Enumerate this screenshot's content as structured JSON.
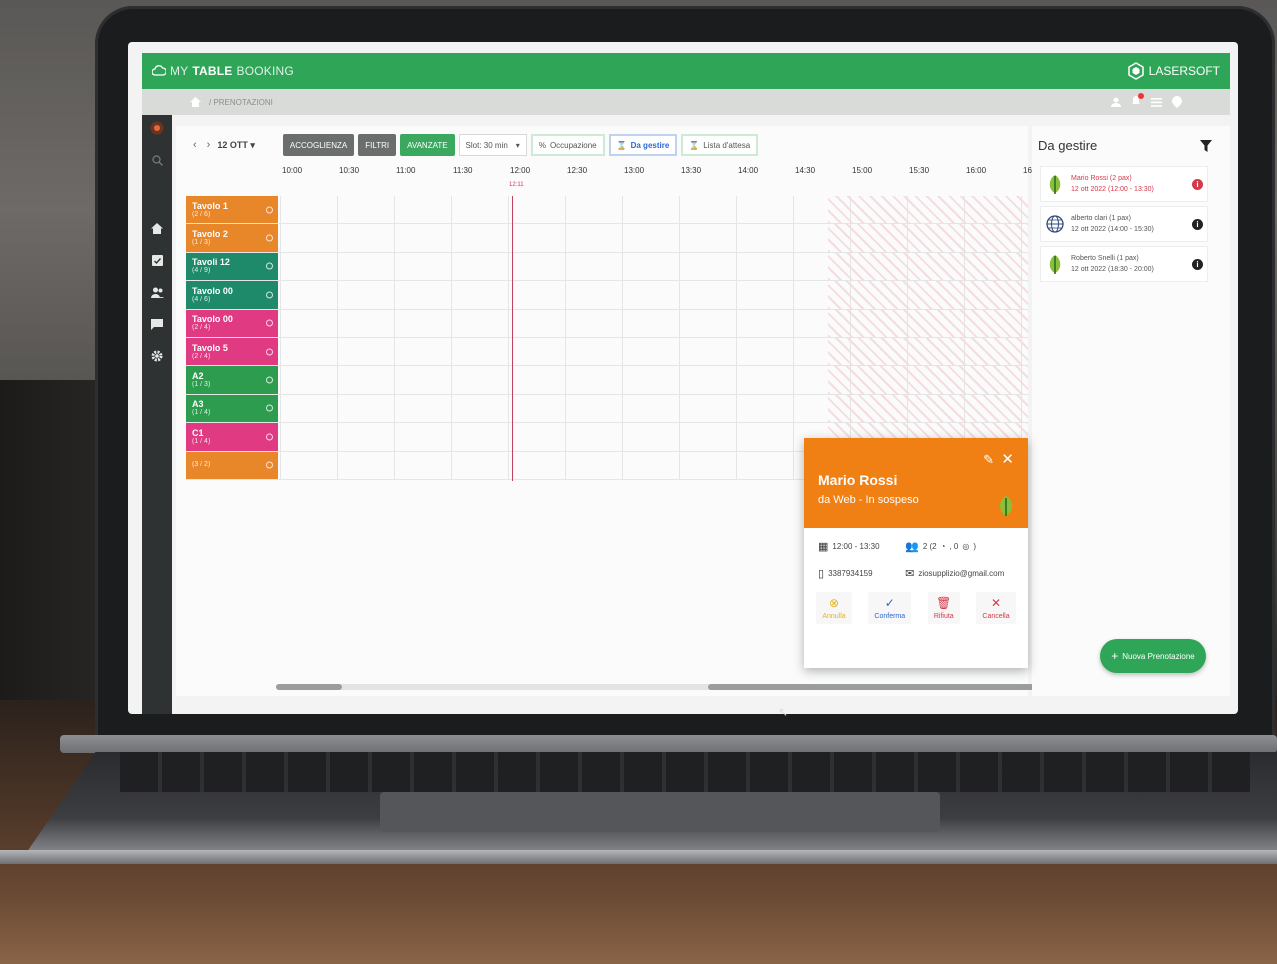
{
  "app": {
    "brand_part1": "MY",
    "brand_part2": "TABLE",
    "brand_part3": "BOOKING",
    "partner": "LASERSOFT"
  },
  "breadcrumb": "/ PRENOTAZIONI",
  "toolbar": {
    "date": "12 OTT",
    "accoglienza": "ACCOGLIENZA",
    "filtri": "FILTRI",
    "avanzate": "AVANZATE",
    "slot": "Slot: 30 min",
    "occupazione": "Occupazione",
    "da_gestire": "Da gestire",
    "lista_attesa": "Lista d'attesa"
  },
  "times": [
    "10:00",
    "10:30",
    "11:00",
    "11:30",
    "12:00",
    "12:30",
    "13:00",
    "13:30",
    "14:00",
    "14:30",
    "15:00",
    "15:30",
    "16:00",
    "16"
  ],
  "now_label": "12:11",
  "tables": [
    {
      "name": "Tavolo 1",
      "cap": "(2 / 6)",
      "color": "#e8862a"
    },
    {
      "name": "Tavolo 2",
      "cap": "(1 / 3)",
      "color": "#e8862a"
    },
    {
      "name": "Tavoli 12",
      "cap": "(4 / 9)",
      "color": "#1f8a6a"
    },
    {
      "name": "Tavolo 00",
      "cap": "(4 / 6)",
      "color": "#1f8a6a"
    },
    {
      "name": "Tavolo 00",
      "cap": "(2 / 4)",
      "color": "#e03a82"
    },
    {
      "name": "Tavolo 5",
      "cap": "(2 / 4)",
      "color": "#e03a82"
    },
    {
      "name": "A2",
      "cap": "(1 / 3)",
      "color": "#2e9c4e"
    },
    {
      "name": "A3",
      "cap": "(1 / 4)",
      "color": "#2e9c4e"
    },
    {
      "name": "C1",
      "cap": "(1 / 4)",
      "color": "#e03a82"
    },
    {
      "name": "",
      "cap": "(3 / 2)",
      "color": "#e8862a"
    }
  ],
  "side_panel": {
    "title": "Da gestire",
    "items": [
      {
        "line1": "Mario Rossi (2 pax)",
        "line2": "12 ott 2022 (12:00 - 13:30)",
        "icon": "leaf-icon",
        "alert": true
      },
      {
        "line1": "alberto clari (1 pax)",
        "line2": "12 ott 2022 (14:00 - 15:30)",
        "icon": "globe-icon",
        "alert": false
      },
      {
        "line1": "Roberto Snelli (1 pax)",
        "line2": "12 ott 2022 (18:30 - 20:00)",
        "icon": "leaf-icon",
        "alert": false
      }
    ]
  },
  "fab_label": "Nuova Prenotazione",
  "popup": {
    "name": "Mario Rossi",
    "subtitle": "da Web - In sospeso",
    "time": "12:00 - 13:30",
    "guests": "2 (2",
    "guests_mid": ", 0",
    "guests_end": ")",
    "phone": "3387934159",
    "email": "ziosupplizio@gmail.com",
    "actions": {
      "annulla": "Annulla",
      "conferma": "Conferma",
      "rifiuta": "Rifiuta",
      "cancella": "Cancella"
    }
  },
  "colors": {
    "brand_green": "#2fa557",
    "popup_orange": "#f07f14",
    "alert_red": "#d23a4b"
  }
}
